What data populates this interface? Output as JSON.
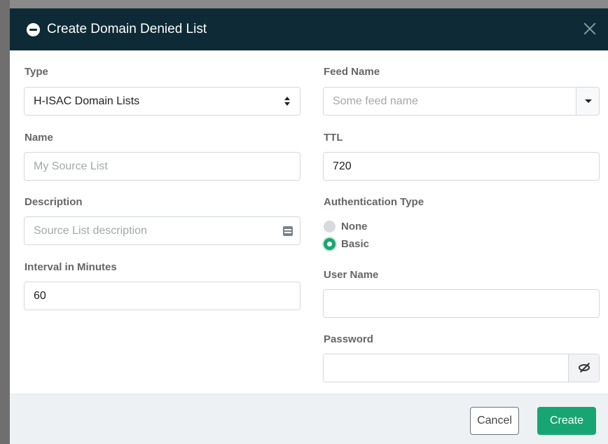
{
  "modal": {
    "title": "Create Domain Denied List",
    "header_icon": "minus-circle-icon",
    "close_icon": "close-icon"
  },
  "form": {
    "type": {
      "label": "Type",
      "value": "H-ISAC Domain Lists"
    },
    "name": {
      "label": "Name",
      "placeholder": "My Source List",
      "value": ""
    },
    "description": {
      "label": "Description",
      "placeholder": "Source List description",
      "value": ""
    },
    "interval": {
      "label": "Interval in Minutes",
      "value": "60"
    },
    "feed_name": {
      "label": "Feed Name",
      "placeholder": "Some feed name",
      "value": ""
    },
    "ttl": {
      "label": "TTL",
      "value": "720"
    },
    "auth_type": {
      "label": "Authentication Type",
      "options": [
        {
          "label": "None",
          "selected": false
        },
        {
          "label": "Basic",
          "selected": true
        }
      ]
    },
    "user_name": {
      "label": "User Name",
      "value": ""
    },
    "password": {
      "label": "Password",
      "value": ""
    }
  },
  "footer": {
    "cancel_label": "Cancel",
    "create_label": "Create"
  },
  "colors": {
    "header_bg": "#0d2a36",
    "accent": "#17a673",
    "footer_bg": "#eef1f4"
  }
}
